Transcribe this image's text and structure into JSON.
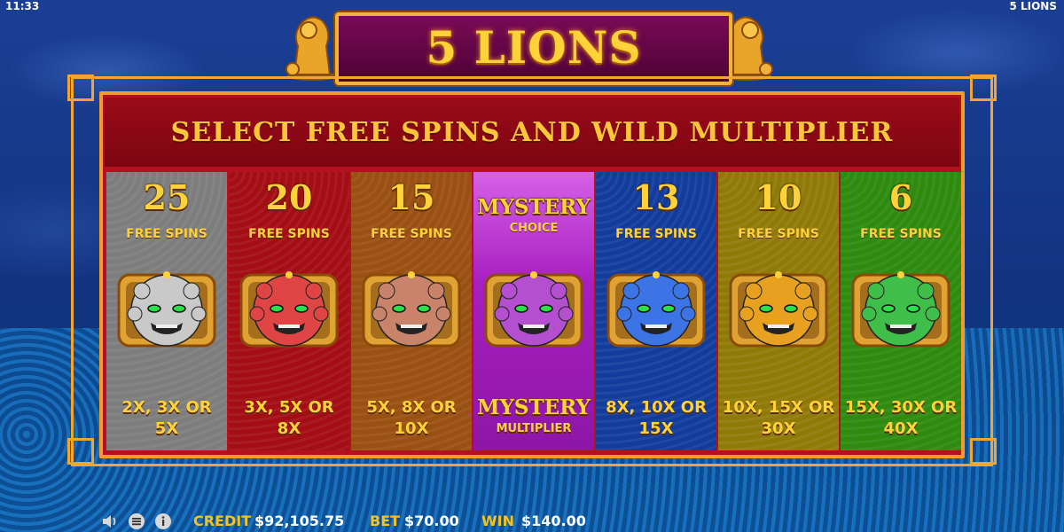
{
  "status": {
    "time": "11:33",
    "game_name": "5 LIONS"
  },
  "title": {
    "text": "5 LIONS"
  },
  "header": {
    "text": "SELECT FREE SPINS AND WILD MULTIPLIER"
  },
  "options": [
    {
      "count": "25",
      "sub": "FREE SPINS",
      "mult_line1": "2X, 3X OR",
      "mult_line2": "5X",
      "color": "#7d7d7d",
      "lion_color": "#c9c9c9"
    },
    {
      "count": "20",
      "sub": "FREE SPINS",
      "mult_line1": "3X, 5X OR",
      "mult_line2": "8X",
      "color": "#a40d14",
      "lion_color": "#e04545"
    },
    {
      "count": "15",
      "sub": "FREE SPINS",
      "mult_line1": "5X, 8X OR",
      "mult_line2": "10X",
      "color": "#9a5012",
      "lion_color": "#c9836a"
    },
    {
      "count": "MYSTERY",
      "sub": "CHOICE",
      "mult_line1": "MYSTERY",
      "mult_line2": "MULTIPLIER",
      "color": "#b528c6",
      "lion_color": "#b44fd0"
    },
    {
      "count": "13",
      "sub": "FREE SPINS",
      "mult_line1": "8X, 10X OR",
      "mult_line2": "15X",
      "color": "#123c9c",
      "lion_color": "#3c74e6"
    },
    {
      "count": "10",
      "sub": "FREE SPINS",
      "mult_line1": "10X, 15X OR",
      "mult_line2": "30X",
      "color": "#8f7a08",
      "lion_color": "#e8a020"
    },
    {
      "count": "6",
      "sub": "FREE SPINS",
      "mult_line1": "15X, 30X OR",
      "mult_line2": "40X",
      "color": "#2f8a10",
      "lion_color": "#3fbf4a"
    }
  ],
  "footer": {
    "credit_label": "CREDIT",
    "credit_value": "$92,105.75",
    "bet_label": "BET",
    "bet_value": "$70.00",
    "win_label": "WIN",
    "win_value": "$140.00"
  },
  "icons": {
    "sound": "speaker-icon",
    "menu": "menu-icon",
    "info": "info-icon"
  },
  "colors": {
    "accent_gold": "#ffd23a",
    "frame_orange": "#f3a533",
    "panel_red": "#b5101f"
  }
}
